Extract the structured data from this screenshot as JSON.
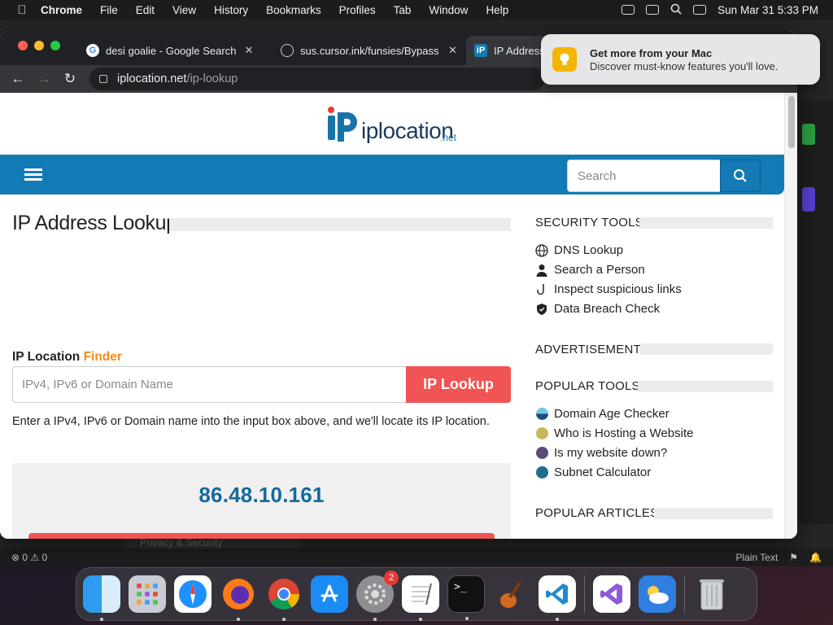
{
  "menubar": {
    "app": "Chrome",
    "items": [
      "File",
      "Edit",
      "View",
      "History",
      "Bookmarks",
      "Profiles",
      "Tab",
      "Window",
      "Help"
    ],
    "datetime": "Sun Mar 31  5:33 PM"
  },
  "browser": {
    "tabs": [
      {
        "title": "desi goalie - Google Search"
      },
      {
        "title": "sus.cursor.ink/funsies/Bypass"
      },
      {
        "title": "IP Address"
      }
    ],
    "url_domain": "iplocation.net",
    "url_path": "/ip-lookup"
  },
  "site": {
    "logo_word": "iplocation",
    "logo_tld": ".net",
    "search_placeholder": "Search",
    "page_title": "IP Address Lookup",
    "finder_label": "IP Location ",
    "finder_accent": "Finder",
    "input_placeholder": "IPv4, IPv6 or Domain Name",
    "lookup_button": "IP Lookup",
    "help_text": "Enter a IPv4, IPv6 or Domain name into the input box above, and we'll locate its IP location.",
    "result_ip": "86.48.10.161"
  },
  "sidebar": {
    "security_heading": "SECURITY TOOLS",
    "security_items": [
      "DNS Lookup",
      "Search a Person",
      "Inspect suspicious links",
      "Data Breach Check"
    ],
    "ad_heading": "ADVERTISEMENT",
    "popular_heading": "POPULAR TOOLS",
    "popular_items": [
      "Domain Age Checker",
      "Who is Hosting a Website",
      "Is my website down?",
      "Subnet Calculator"
    ],
    "articles_heading": "POPULAR ARTICLES"
  },
  "notification": {
    "title": "Get more from your Mac",
    "subtitle": "Discover must-know features you'll love."
  },
  "editor_behind": {
    "status_left": "⊗ 0 ⚠ 0",
    "status_right": "Plain Text",
    "settings_item": "Privacy & Security"
  },
  "dock": {
    "settings_badge": "2"
  },
  "colors": {
    "site_blue": "#137ab5",
    "lookup_red": "#f05454",
    "accent_orange": "#f08c1e",
    "ip_blue": "#136a9c"
  }
}
